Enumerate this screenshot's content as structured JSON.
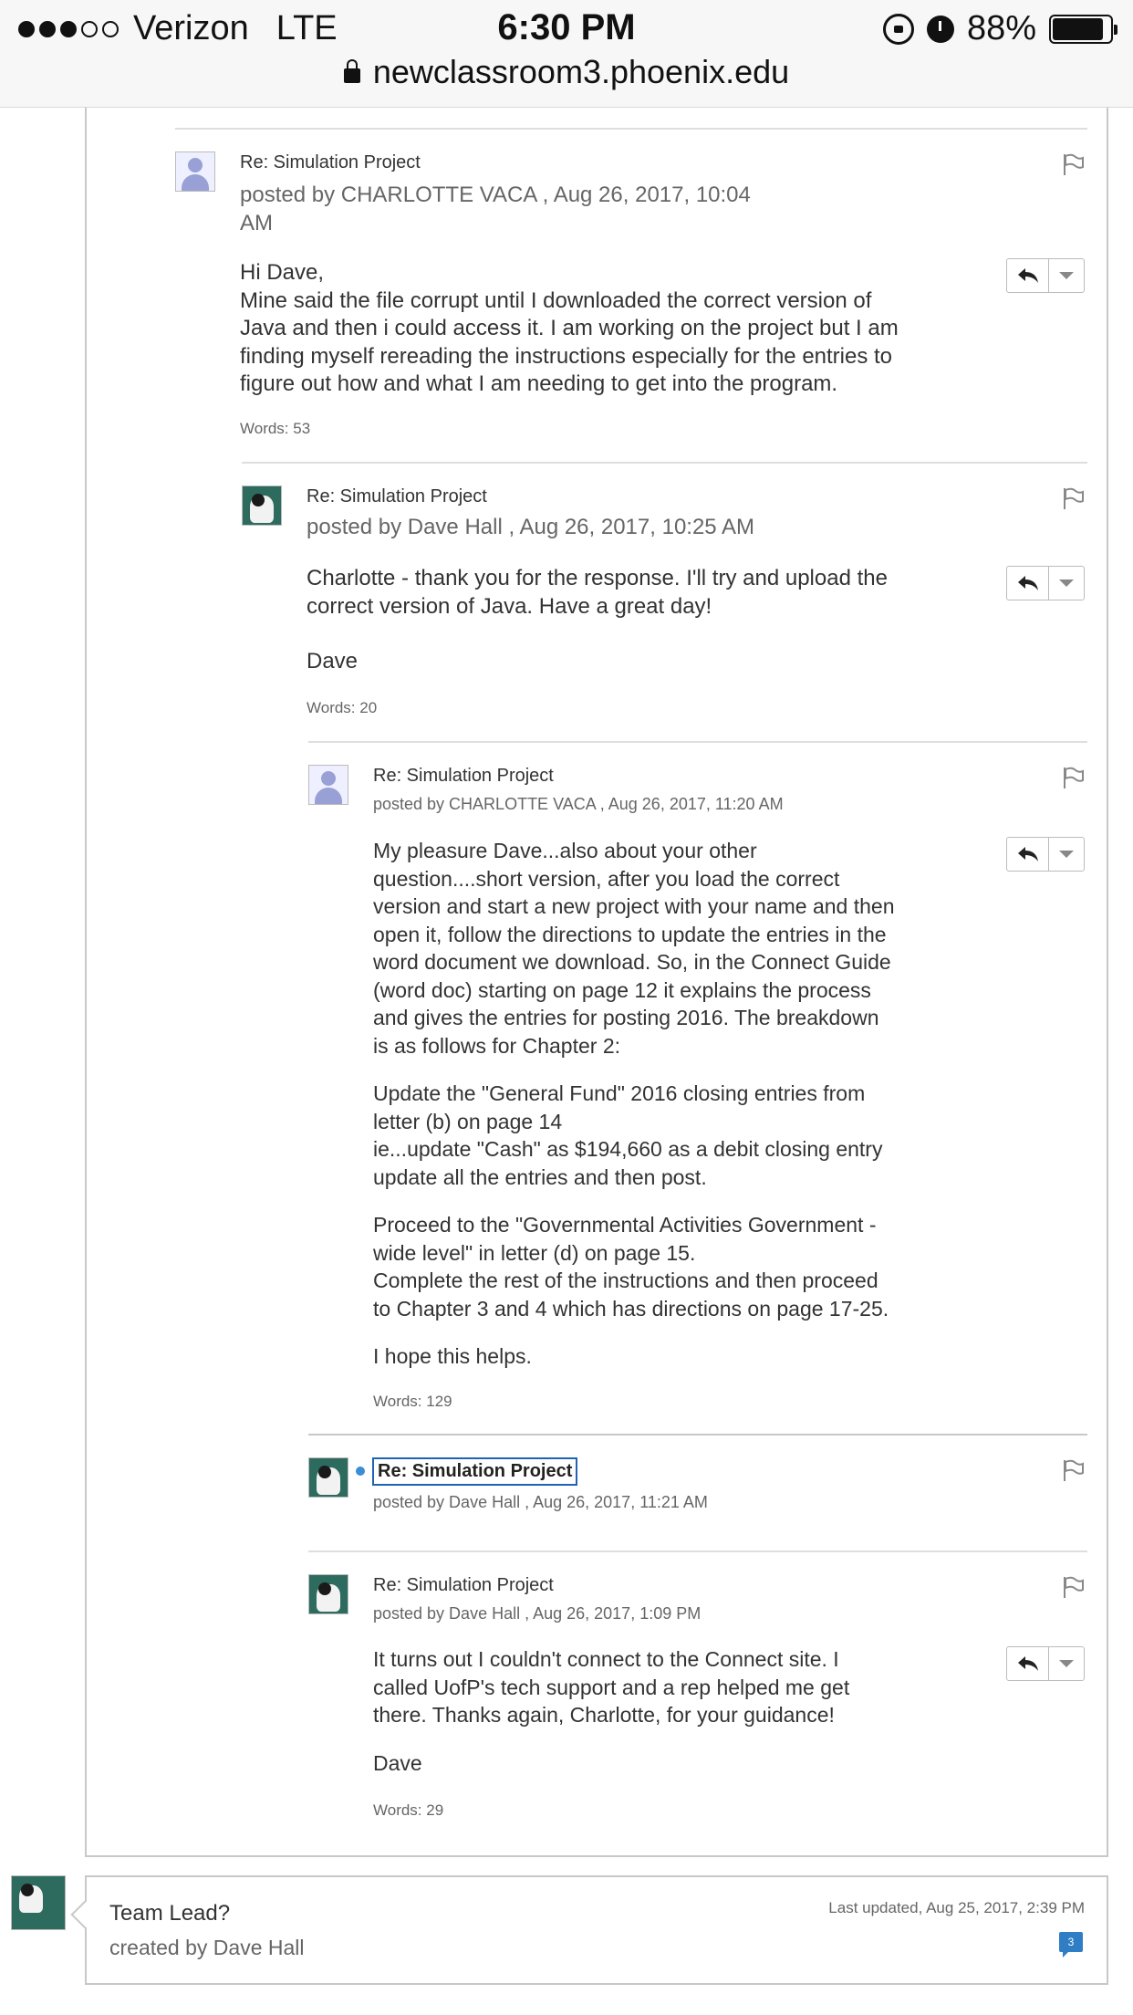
{
  "status_bar": {
    "carrier": "Verizon",
    "network": "LTE",
    "time": "6:30 PM",
    "battery": "88%",
    "battery_fraction": 0.88,
    "url": "newclassroom3.phoenix.edu",
    "icons": [
      "signal-dots",
      "orientation-lock-icon",
      "alarm-icon",
      "battery-icon",
      "lock-icon"
    ]
  },
  "posts": [
    {
      "subject": "Re: Simulation Project",
      "byline_line1": "posted by CHARLOTTE VACA , Aug 26, 2017, 10:04",
      "byline_line2": "AM",
      "avatar": "default",
      "body": [
        "Hi Dave,",
        "Mine said the file corrupt until I downloaded the correct version of",
        "Java and then i could access it. I am working on the project but I am",
        "finding myself rereading the instructions especially for the entries to",
        "figure out how and what I am needing to get into the program."
      ],
      "words": "Words: 53"
    },
    {
      "subject": "Re: Simulation Project",
      "byline": "posted by Dave Hall , Aug 26, 2017, 10:25 AM",
      "avatar": "dog",
      "body": [
        "Charlotte - thank you for the response.  I'll try and upload the",
        "correct version of Java.  Have a great day!",
        "Dave"
      ],
      "words": "Words: 20"
    },
    {
      "subject": "Re: Simulation Project",
      "byline": "posted by CHARLOTTE VACA , Aug 26, 2017, 11:20 AM",
      "avatar": "default",
      "body": [
        "My pleasure Dave...also about your other",
        "question....short version, after you load the correct",
        "version and start a new project with your name and then",
        "open it, follow the directions to update the entries in the",
        "word document we download. So, in the Connect Guide",
        "(word doc) starting on page 12 it explains the process",
        "and gives the entries for posting 2016. The breakdown",
        "is as follows for Chapter 2:",
        "Update the \"General Fund\" 2016 closing entries from",
        "letter (b) on page 14",
        "ie...update \"Cash\" as $194,660 as a debit closing entry",
        "update all the entries and then post.",
        "Proceed to the \"Governmental Activities Government -",
        "wide level\" in letter (d) on page 15.",
        "Complete the rest of the instructions and then proceed",
        "to Chapter 3 and 4 which has directions on page 17-25.",
        "I hope this helps."
      ],
      "words": "Words: 129"
    },
    {
      "subject": "Re: Simulation Project",
      "byline": "posted by Dave Hall , Aug 26, 2017, 11:21 AM",
      "avatar": "dog",
      "unread": true
    },
    {
      "subject": "Re: Simulation Project",
      "byline": "posted by Dave Hall , Aug 26, 2017, 1:09 PM",
      "avatar": "dog",
      "body": [
        "It turns out I couldn't connect to the Connect site.  I",
        "called UofP's tech support and a rep helped me get",
        "there.  Thanks again, Charlotte, for your guidance!",
        "Dave"
      ],
      "words": "Words: 29"
    }
  ],
  "thread_card": {
    "title": "Team Lead?",
    "created_by": "created by Dave Hall",
    "last_updated": "Last updated, Aug 25, 2017, 2:39 PM",
    "comment_count": "3"
  },
  "colors": {
    "link_blue": "#1f64b4",
    "unread_dot": "#3a8ed3",
    "badge_blue": "#2f7ec5"
  }
}
